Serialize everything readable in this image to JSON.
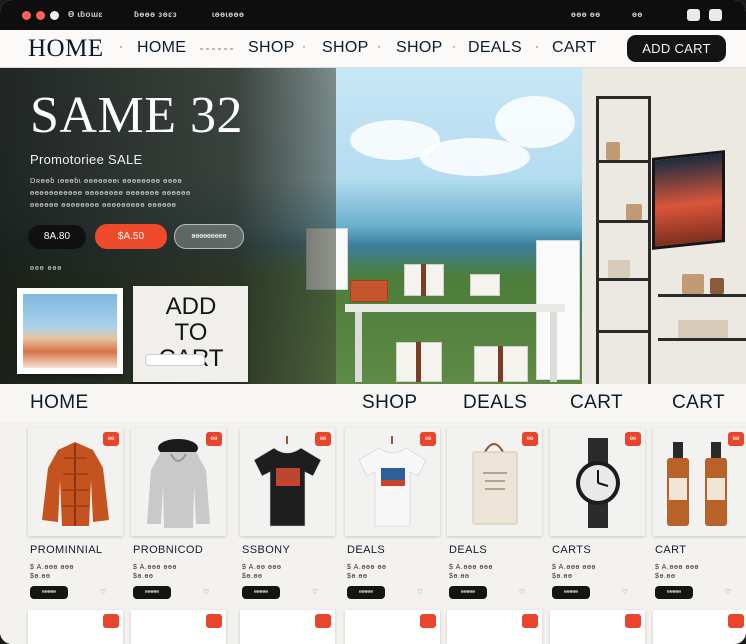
{
  "titlebar": {
    "dots": [
      "#ff5f56",
      "#ff5f56",
      "#f0f0f0"
    ],
    "items": [
      "Ɵ ɩɓoɯɛ",
      "ɓɵɵɵ ɜɵɛɜ",
      "ɩɵɵɩɵɵɵ"
    ],
    "right_items": [
      "ɵɵɵ ɵɵ",
      "ɵɵ"
    ]
  },
  "nav": {
    "logo": "HOME",
    "links": [
      "HOME",
      "SHOP",
      "SHOP",
      "SHOP",
      "DEALS",
      "CART"
    ],
    "cta": "ADD CART"
  },
  "hero": {
    "headline": "SAME 32",
    "subheadline": "Promotoriee SALE",
    "description": [
      "Dʀɵɵɓ ɩɵɵɵɓɩ ɵɵɵɵɵɵɵɩ ɵɵɵɵɵɵɵɵ ɵɵɵɵ",
      "ɵɵɵɵɵɵɵɵɵɵɵ ɵɵɵɵɵɵɵɵ ɵɵɵɵɵɵɵ ɵɵɵɵɵɵ",
      "ɵɵɵɵɵɵ ɵɵɵɵɵɵɵɵ ɵɵɵɵɵɵɵɵɵ ɵɵɵɵɵɵ"
    ],
    "price_label": "8A.80",
    "sale_label": "$A.50",
    "ghost_label": "ɵɵɵɵɵɵɵɵɵ",
    "tiny_text": "ɵɵɵ  ɵɵɵ",
    "card_title_1": "ADD",
    "card_title_2": "TO CART"
  },
  "sections": [
    "HOME",
    "SHOP",
    "DEALS",
    "CART",
    "CART"
  ],
  "products": [
    {
      "name": "PROMINNIAL",
      "meta": [
        "$ A.ɵɵɵ ɵɵɵ",
        "$ɵ.ɵɵ"
      ],
      "button": "ɵɵɵɵɵ",
      "kind": "jacket",
      "color": "#c4531f"
    },
    {
      "name": "PROBNICOD",
      "meta": [
        "$ A.ɵɵɵ ɵɵɵ",
        "$ɵ.ɵɵ"
      ],
      "button": "ɵɵɵɵɵ",
      "kind": "hoodie",
      "color": "#c9c9c9"
    },
    {
      "name": "SSBONY",
      "meta": [
        "$ A.ɵɵ ɵɵɵ",
        "$ɵ.ɵɵ"
      ],
      "button": "ɵɵɵɵɵ",
      "kind": "tshirt",
      "color": "#1e1e1e"
    },
    {
      "name": "DEALS",
      "meta": [
        "$ A.ɵɵɵ ɵɵ",
        "$ɵ.ɵɵ"
      ],
      "button": "ɵɵɵɵɵ",
      "kind": "tshirt",
      "color": "#f7f7f7"
    },
    {
      "name": "DEALS",
      "meta": [
        "$ A.ɵɵɵ ɵɵɵ",
        "$ɵ.ɵɵ"
      ],
      "button": "ɵɵɵɵɵ",
      "kind": "bag",
      "color": "#ece4d6"
    },
    {
      "name": "CARTS",
      "meta": [
        "$ A.ɵɵɵ ɵɵɵ",
        "$ɵ.ɵɵ"
      ],
      "button": "ɵɵɵɵɵ",
      "kind": "watch",
      "color": "#2b2b2b"
    },
    {
      "name": "CART",
      "meta": [
        "$ A.ɵɵɵ ɵɵɵ",
        "$ɵ.ɵɵ"
      ],
      "button": "ɵɵɵɵɵ",
      "kind": "bottles",
      "color": "#b8622a"
    }
  ]
}
